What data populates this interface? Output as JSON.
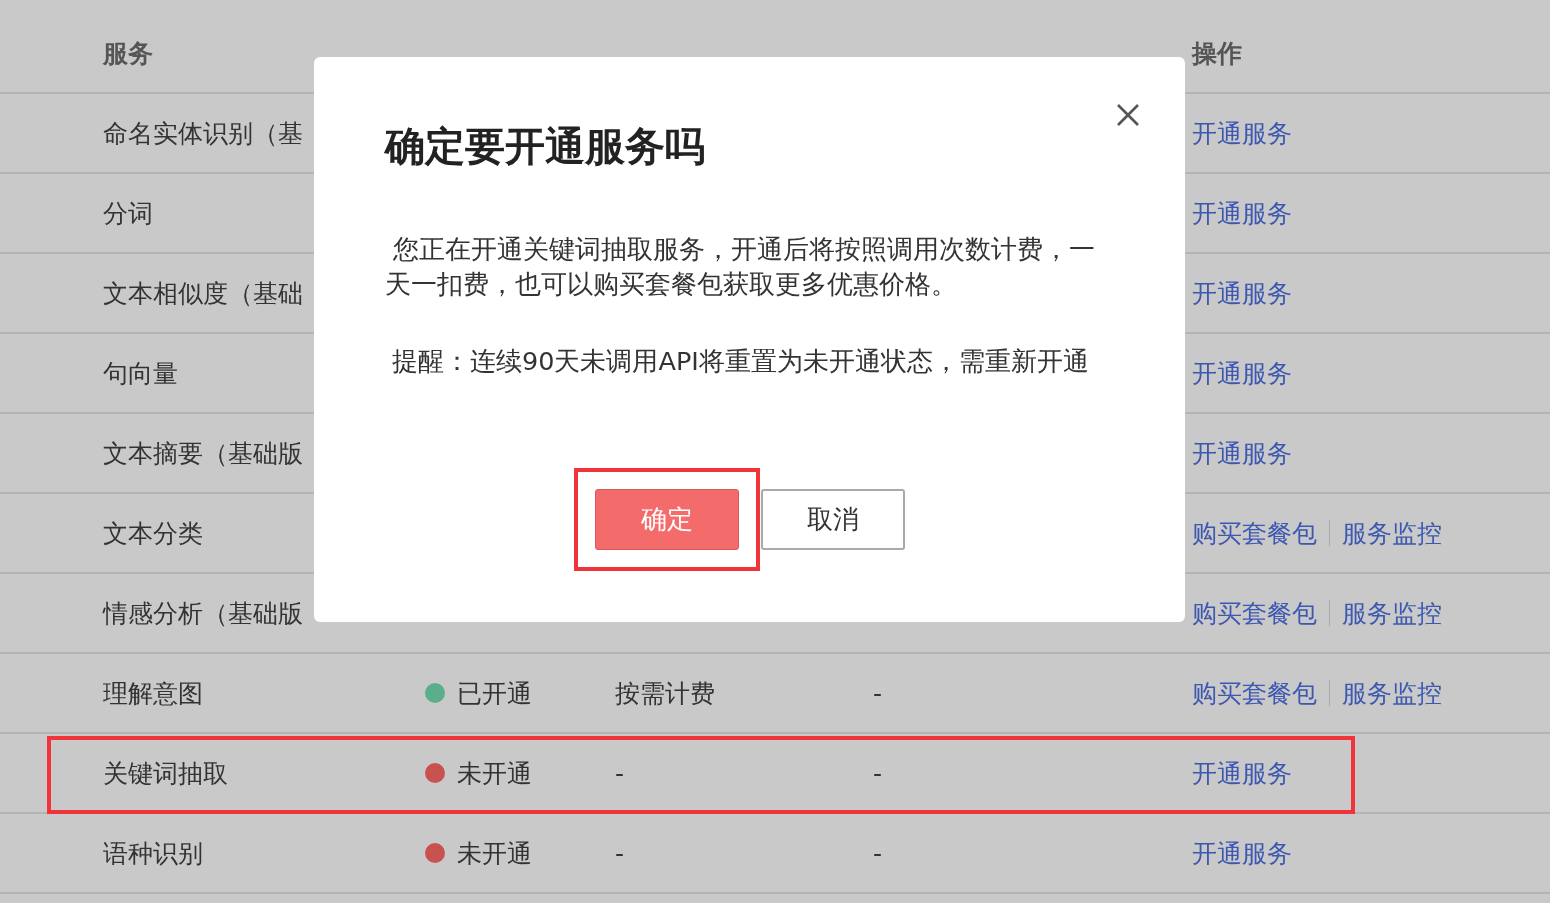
{
  "table": {
    "columns": {
      "service": "服务",
      "actions": "操作"
    },
    "rows": [
      {
        "service": "命名实体识别（基",
        "highlighted": false,
        "actions": [
          "开通服务"
        ]
      },
      {
        "service": "分词",
        "highlighted": false,
        "actions": [
          "开通服务"
        ]
      },
      {
        "service": "文本相似度（基础",
        "highlighted": false,
        "actions": [
          "开通服务"
        ]
      },
      {
        "service": "句向量",
        "highlighted": false,
        "actions": [
          "开通服务"
        ]
      },
      {
        "service": "文本摘要（基础版",
        "highlighted": false,
        "actions": [
          "开通服务"
        ]
      },
      {
        "service": "文本分类",
        "highlighted": false,
        "actions": [
          "购买套餐包",
          "服务监控"
        ]
      },
      {
        "service": "情感分析（基础版",
        "highlighted": false,
        "actions": [
          "购买套餐包",
          "服务监控"
        ]
      },
      {
        "service": "理解意图",
        "highlighted": false,
        "status": {
          "label": "已开通",
          "color": "#5aae8c"
        },
        "billing": "按需计费",
        "column_4": "-",
        "actions": [
          "购买套餐包",
          "服务监控"
        ]
      },
      {
        "service": "关键词抽取",
        "highlighted": true,
        "status": {
          "label": "未开通",
          "color": "#c8524f"
        },
        "billing": "-",
        "column_4": "-",
        "actions": [
          "开通服务"
        ]
      },
      {
        "service": "语种识别",
        "highlighted": false,
        "status": {
          "label": "未开通",
          "color": "#c8524f"
        },
        "billing": "-",
        "column_4": "-",
        "actions": [
          "开通服务"
        ]
      }
    ]
  },
  "dialog": {
    "title": "确定要开通服务吗",
    "message": "您正在开通关键词抽取服务，开通后将按照调用次数计费，一天一扣费，也可以购买套餐包获取更多优惠价格。",
    "reminder": "提醒：连续90天未调用API将重置为未开通状态，需重新开通",
    "buttons": [
      {
        "label": "确定",
        "kind": "primary",
        "highlighted": true
      },
      {
        "label": "取消",
        "kind": "secondary",
        "highlighted": false
      }
    ]
  }
}
